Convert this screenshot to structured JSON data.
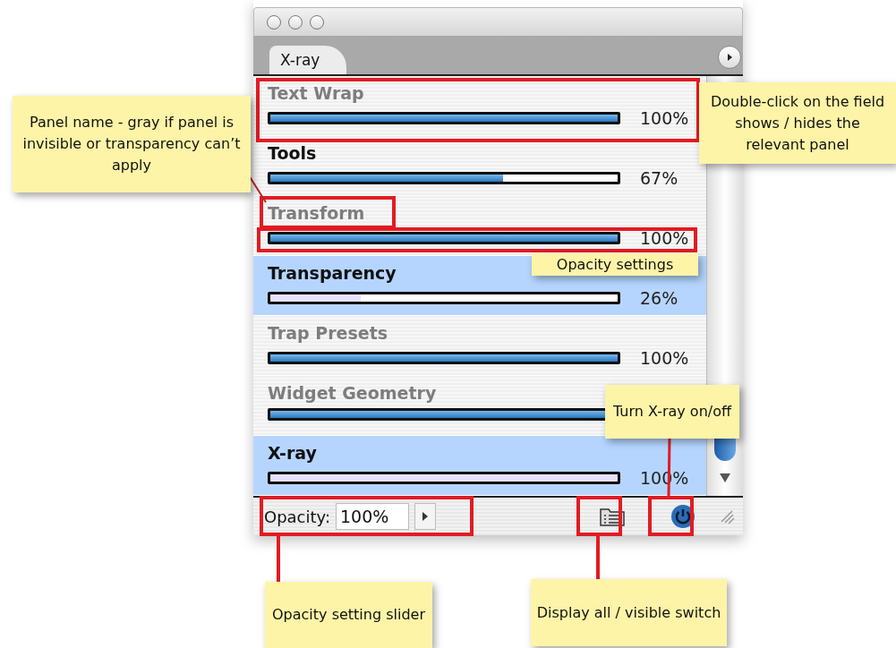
{
  "window": {
    "tab": "X-ray"
  },
  "rows": [
    {
      "name": "Text Wrap",
      "grayed": true,
      "selected": false,
      "level": 1,
      "reading": "100%"
    },
    {
      "name": "Tools",
      "grayed": false,
      "selected": false,
      "level": 0.67,
      "reading": "67%"
    },
    {
      "name": "Transform",
      "grayed": true,
      "selected": false,
      "level": 1,
      "reading": "100%"
    },
    {
      "name": "Transparency",
      "grayed": false,
      "selected": true,
      "level": 0.26,
      "reading": "26%"
    },
    {
      "name": "Trap Presets",
      "grayed": true,
      "selected": false,
      "level": 1,
      "reading": "100%"
    },
    {
      "name": "Widget Geometry",
      "grayed": true,
      "selected": false,
      "level": 1
    },
    {
      "name": "X-ray",
      "grayed": false,
      "selected": true,
      "level": 1,
      "reading": "100%"
    }
  ],
  "footer": {
    "label": "Opacity:",
    "value": "100%"
  },
  "callouts": [
    {
      "text": "Double-click on the field shows / hides the relevant panel"
    },
    {
      "text": "Panel name - gray if panel is invisible or transparency can’t apply"
    },
    {
      "text": "Opacity settings"
    },
    {
      "text": "Turn X-ray on/off"
    },
    {
      "text": "Opacity setting slider"
    },
    {
      "text": "Display all / visible switch"
    }
  ]
}
